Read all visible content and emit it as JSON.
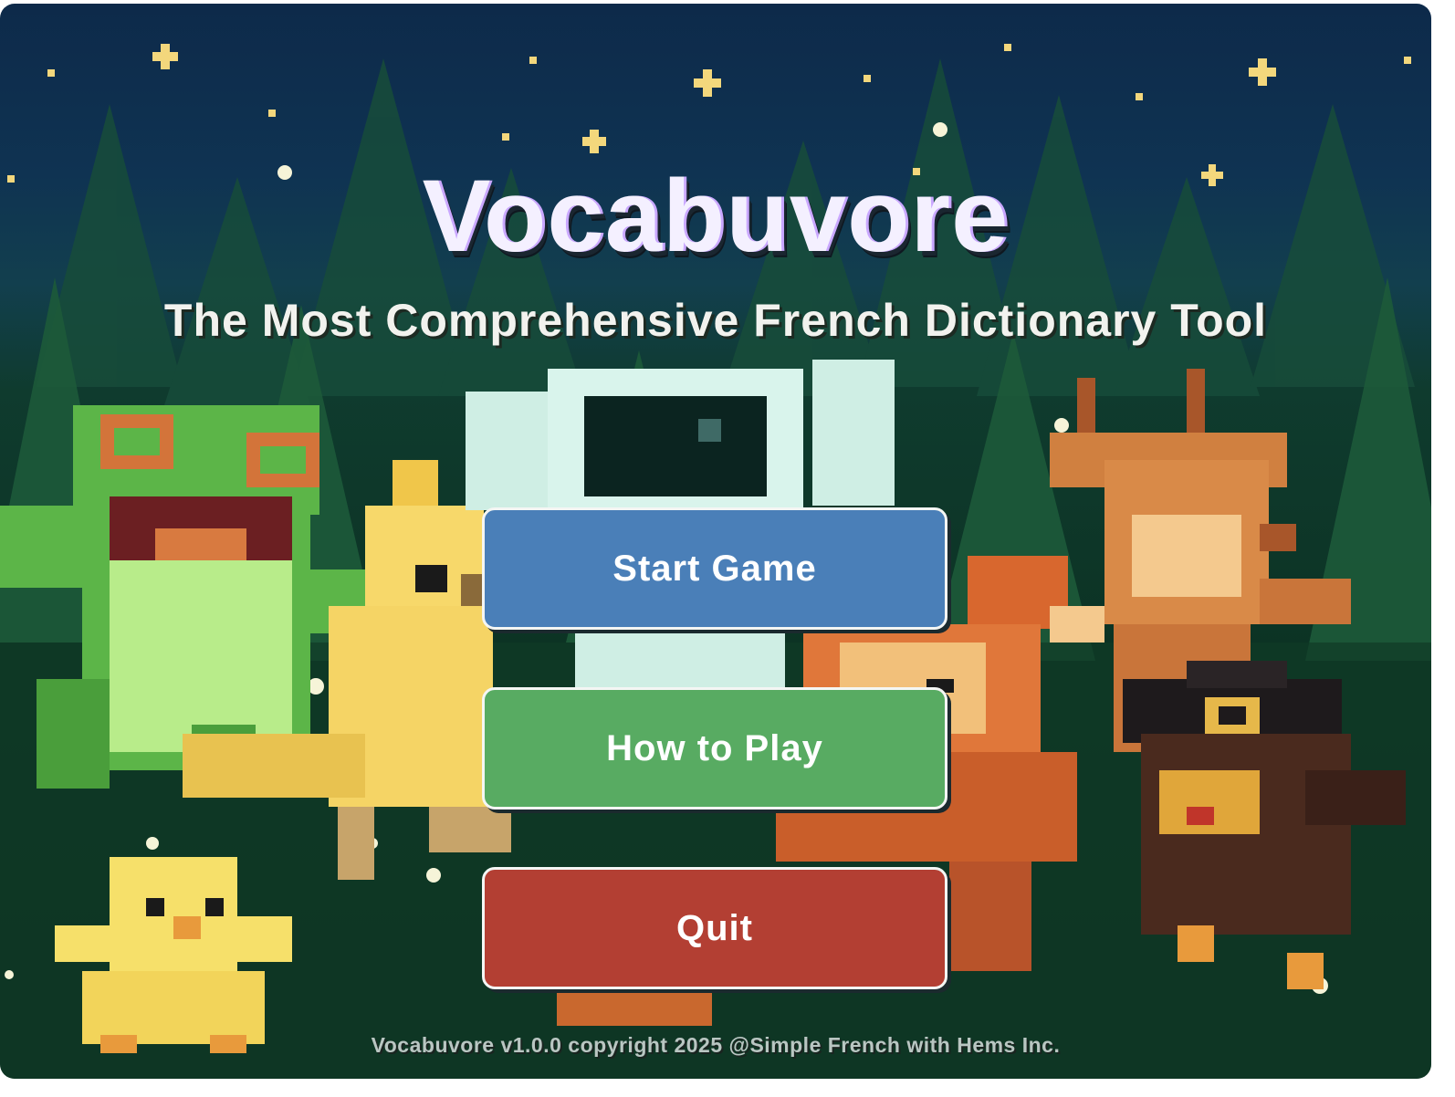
{
  "title": "Vocabuvore",
  "subtitle": "The Most Comprehensive French Dictionary Tool",
  "menu": {
    "start_label": "Start Game",
    "howto_label": "How to Play",
    "quit_label": "Quit"
  },
  "footer": "Vocabuvore v1.0.0 copyright 2025 @Simple French with Hems Inc.",
  "colors": {
    "start": "#4a7fb8",
    "howto": "#58ab62",
    "quit": "#b33f33",
    "night_sky": "#0d2a4a",
    "forest": "#0c3324"
  },
  "characters": [
    "frog",
    "astronaut",
    "parrot",
    "chick",
    "fox",
    "deer",
    "pirate-bird"
  ]
}
